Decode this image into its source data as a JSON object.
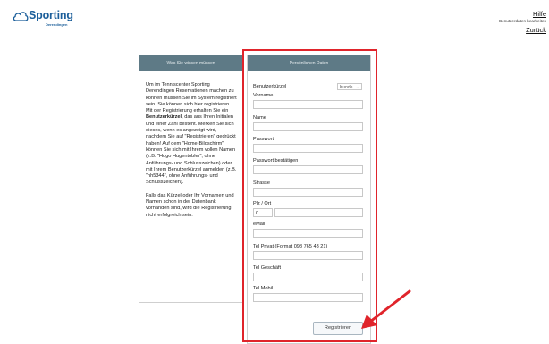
{
  "brand": {
    "name": "Sporting",
    "sub": "Derendingen"
  },
  "topnav": {
    "help": "Hilfe",
    "subtitle": "Benutzerdaten bearbeiten",
    "back": "Zurück"
  },
  "left_panel": {
    "title": "Was Sie wissen müssen",
    "p1_a": "Um im Tenniscenter Sporting Derendingen Reservationen machen zu können müssen Sie im System registriert sein. Sie können sich hier registrieren. Mit der Registrierung erhalten Sie ein ",
    "p1_b": "Benutzerkürzel",
    "p1_c": ", das aus Ihren Initialen und einer Zahl besteht. Merken Sie sich dieses, wenn es angezeigt wird, nachdem Sie auf \"Registrieren\" gedrückt haben! Auf dem \"Home-Bildschirm\" können Sie sich mit Ihrem vollen Namen (z.B. \"Hugo Hugentobler\", ohne Anführungs- und Schlusszeichen) oder mit Ihrem Benutzerkürzel anmelden (z.B. \"hh5344\", ohne Anführungs- und Schlusszeichen).",
    "p2": "Falls das Kürzel oder Ihr Vornamen und Namen schon in der Datenbank vorhanden sind, wird die Registrierung nicht erfolgreich sein."
  },
  "right_panel": {
    "title": "Persönlichen Daten",
    "benutzer_label": "Benutzerkürzel",
    "kunde_select": "Kunde",
    "vorname_label": "Vorname",
    "name_label": "Name",
    "passwort_label": "Passwort",
    "passwort2_label": "Passwort bestätigen",
    "strasse_label": "Strasse",
    "plz_label": "Plz / Ort",
    "plz_value": "0",
    "email_label": "eMail",
    "telprivat_label": "Tel Privat (Format 098 765 43 21)",
    "telgeschaeft_label": "Tel Geschäft",
    "telmobil_label": "Tel Mobil",
    "register_button": "Registrieren"
  },
  "colors": {
    "panel_header": "#5e7a86",
    "highlight": "#e0242b",
    "brand": "#1b5e9a"
  }
}
